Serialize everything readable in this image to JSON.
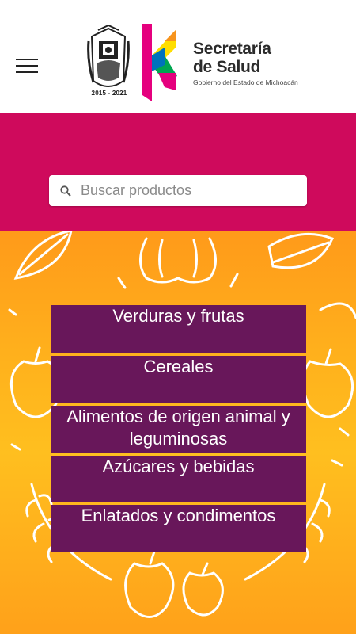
{
  "header": {
    "menu_icon": "hamburger-menu-icon",
    "seal_years": "2015 - 2021",
    "brand_line1": "Secretaría",
    "brand_line2": "de Salud",
    "brand_sub": "Gobierno del Estado de Michoacán",
    "colors": {
      "magenta": "#e5007e",
      "yellow": "#ffde00",
      "green": "#00a651",
      "blue": "#0072bc",
      "orange": "#f7941d"
    }
  },
  "banner": {
    "color": "#cf0a5c"
  },
  "search": {
    "placeholder": "Buscar productos",
    "value": "",
    "icon": "search-icon"
  },
  "background": {
    "color_top": "#ff9a1a",
    "color_mid": "#ffbf1f"
  },
  "categories": [
    {
      "label": "Verduras y frutas"
    },
    {
      "label": "Cereales"
    },
    {
      "label": "Alimentos de origen animal y leguminosas"
    },
    {
      "label": "Azúcares y bebidas"
    },
    {
      "label": "Enlatados y condimentos"
    }
  ],
  "category_color": "#68175a"
}
